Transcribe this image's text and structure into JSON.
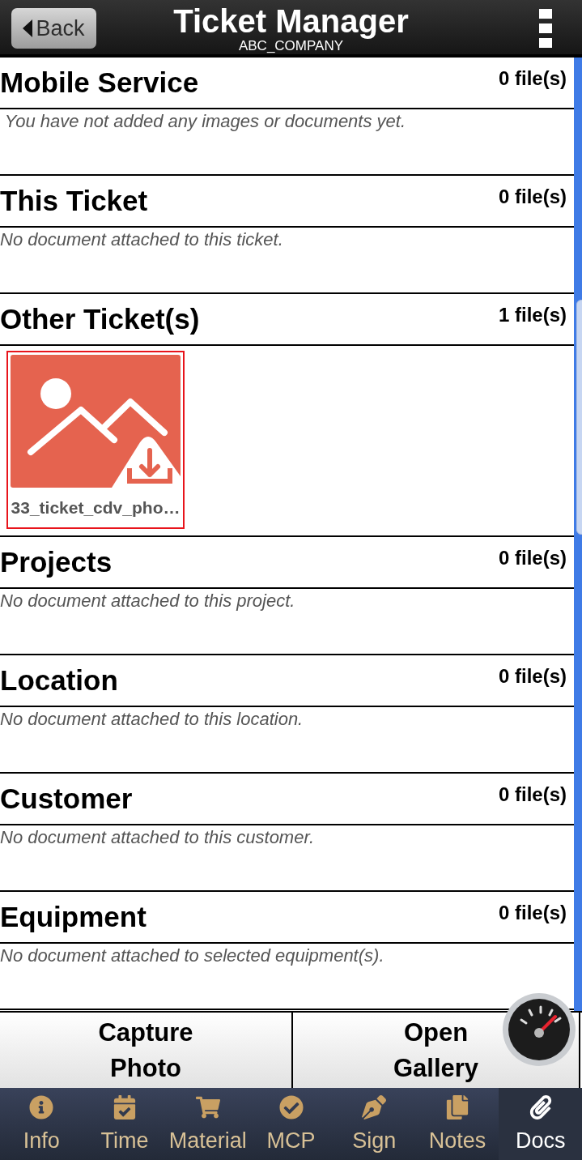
{
  "header": {
    "back_button": "Back",
    "title": "Ticket Manager",
    "subtitle": "ABC_COMPANY"
  },
  "sections": [
    {
      "title": "Mobile Service",
      "count": "0 file(s)",
      "message": " You have not added any images or documents yet."
    },
    {
      "title": "This Ticket",
      "count": "0 file(s)",
      "message": "No document attached to this ticket."
    },
    {
      "title": "Other Ticket(s)",
      "count": "1 file(s)",
      "files": [
        {
          "name": "33_ticket_cdv_pho…",
          "selected": true
        }
      ]
    },
    {
      "title": "Projects",
      "count": "0 file(s)",
      "message": "No document attached to this project."
    },
    {
      "title": "Location",
      "count": "0 file(s)",
      "message": "No document attached to this location."
    },
    {
      "title": "Customer",
      "count": "0 file(s)",
      "message": "No document attached to this customer."
    },
    {
      "title": "Equipment",
      "count": "0 file(s)",
      "message": "No document attached to selected equipment(s)."
    }
  ],
  "actions": [
    "Capture Photo",
    "Open Gallery"
  ],
  "tabs": [
    {
      "label": "Info",
      "selected": false
    },
    {
      "label": "Time",
      "selected": false
    },
    {
      "label": "Material",
      "selected": false
    },
    {
      "label": "MCP",
      "selected": false
    },
    {
      "label": "Sign",
      "selected": false
    },
    {
      "label": "Notes",
      "selected": false
    },
    {
      "label": "Docs",
      "selected": true
    }
  ]
}
